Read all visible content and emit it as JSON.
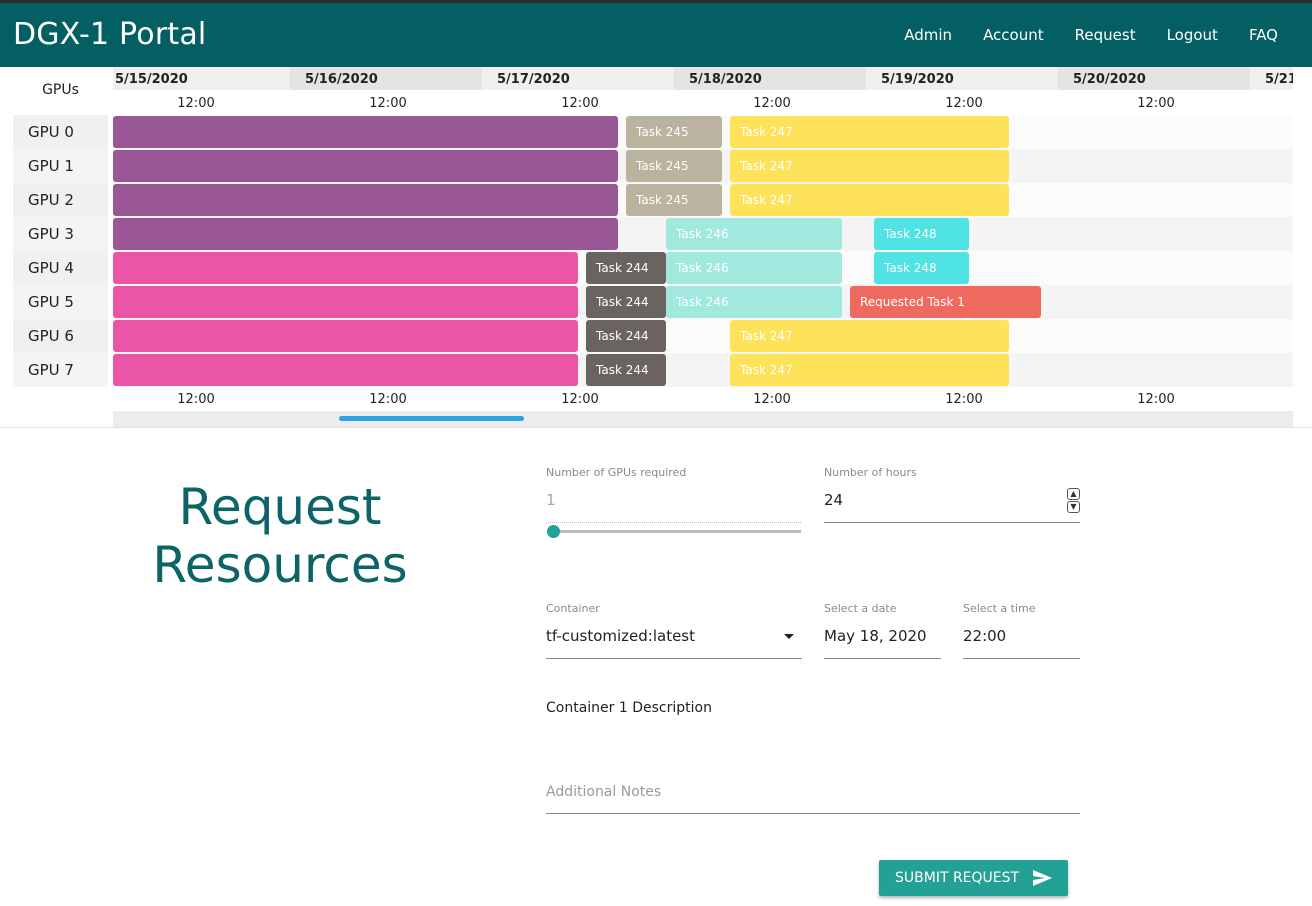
{
  "header": {
    "brand": "DGX-1 Portal",
    "nav": [
      "Admin",
      "Account",
      "Request",
      "Logout",
      "FAQ"
    ]
  },
  "timeline": {
    "gpus_header": "GPUs",
    "dates": [
      "5/15/2020",
      "5/16/2020",
      "5/17/2020",
      "5/18/2020",
      "5/19/2020",
      "5/20/2020",
      "5/21"
    ],
    "time_label": "12:00",
    "rows": [
      "GPU 0",
      "GPU 1",
      "GPU 2",
      "GPU 3",
      "GPU 4",
      "GPU 5",
      "GPU 6",
      "GPU 7"
    ],
    "task_labels": {
      "t245": "Task 245",
      "t247": "Task 247",
      "t246": "Task 246",
      "t248": "Task 248",
      "t244": "Task 244",
      "req1": "Requested Task 1"
    },
    "colors": {
      "purple": "#9a5795",
      "pink": "#ea55a5",
      "beige": "#b9b39f",
      "yellow": "#fde25a",
      "mint": "#a1e9df",
      "cyan": "#50e3e3",
      "gray": "#6b6360",
      "red": "#ee6a5f"
    }
  },
  "form": {
    "title": "Request Resources",
    "gpus_label": "Number of GPUs required",
    "gpus_value": "1",
    "hours_label": "Number of hours",
    "hours_value": "24",
    "container_label": "Container",
    "container_value": "tf-customized:latest",
    "date_label": "Select a date",
    "date_value": "May 18, 2020",
    "time_label": "Select a time",
    "time_value": "22:00",
    "description": "Container 1 Description",
    "notes_placeholder": "Additional Notes",
    "submit_label": "SUBMIT REQUEST"
  }
}
